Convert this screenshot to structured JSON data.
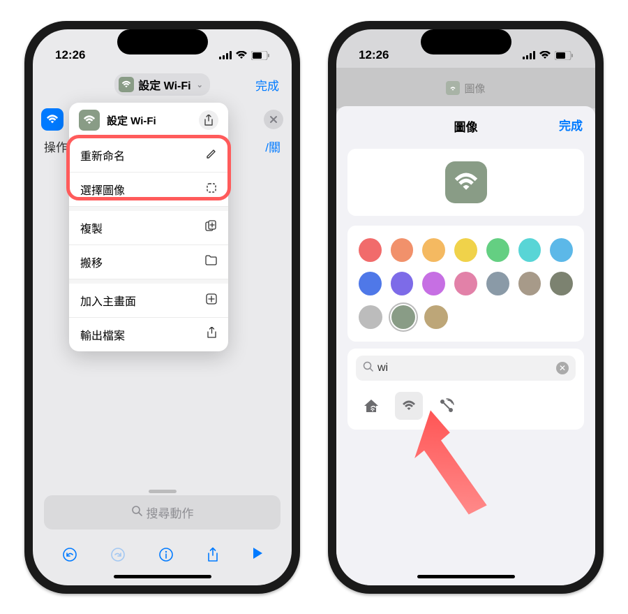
{
  "status": {
    "time": "12:26"
  },
  "phone1": {
    "title_chip": "設定 Wi-Fi",
    "done": "完成",
    "row2_left": "操作",
    "row2_right": "/關",
    "popup": {
      "title": "設定 Wi-Fi",
      "items": {
        "rename": "重新命名",
        "choose_image": "選擇圖像",
        "duplicate": "複製",
        "move": "搬移",
        "add_home": "加入主畫面",
        "export": "輸出檔案"
      }
    },
    "search_placeholder": "搜尋動作"
  },
  "phone2": {
    "dim_title": "圖像",
    "sheet_title": "圖像",
    "done": "完成",
    "search_value": "wi",
    "colors": {
      "row1": [
        "#f16b6b",
        "#f1916b",
        "#f4b961",
        "#f0d24a",
        "#64cf82",
        "#58d5d6",
        "#5cb8e8"
      ],
      "row2": [
        "#4f78e8",
        "#7d6be8",
        "#c66fe3",
        "#e281a8",
        "#8a9aa7",
        "#a79a89",
        "#7c8270"
      ],
      "row3": [
        "#bcbcbc",
        "#899c86",
        "#bda678"
      ]
    },
    "selected_color": "#899c86"
  }
}
